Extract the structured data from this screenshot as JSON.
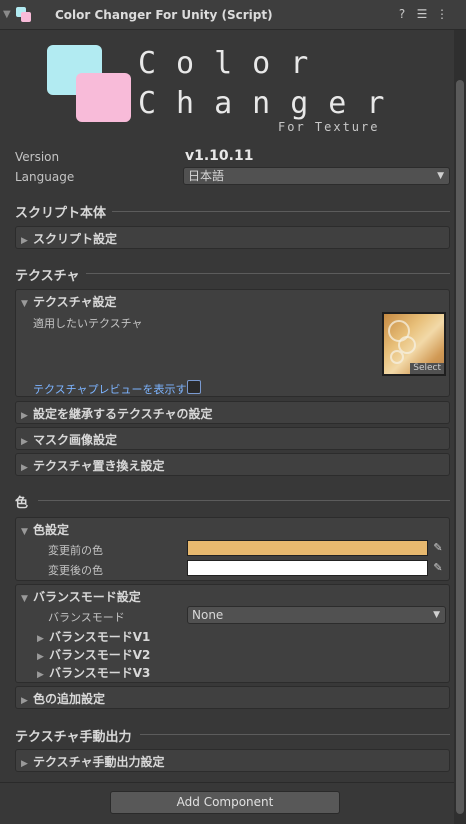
{
  "header": {
    "title": "Color Changer For Unity (Script)",
    "help_icon": "help-icon",
    "settings_icon": "preset-settings-icon",
    "menu_icon": "kebab-menu-icon"
  },
  "logo": {
    "line1": "Color",
    "line2": "Changer",
    "subtitle": "For Texture",
    "colors": {
      "cyan": "#b2ebf2",
      "pink": "#f8bbd9"
    }
  },
  "info": {
    "version_label": "Version",
    "version_value": "v1.10.11",
    "language_label": "Language",
    "language_value": "日本語"
  },
  "sections": {
    "script": {
      "title": "スクリプト本体",
      "foldout": "スクリプト設定"
    },
    "texture": {
      "title": "テクスチャ",
      "foldout_open": "テクスチャ設定",
      "target_label": "適用したいテクスチャ",
      "select_label": "Select",
      "preview_label": "テクスチャプレビューを表示する",
      "preview_checked": false,
      "foldouts": [
        "設定を継承するテクスチャの設定",
        "マスク画像設定",
        "テクスチャ置き換え設定"
      ]
    },
    "color": {
      "title": "色",
      "foldout_open": "色設定",
      "before_label": "変更前の色",
      "before_color": "#e8b96f",
      "after_label": "変更後の色",
      "after_color": "#ffffff",
      "balance_foldout": "バランスモード設定",
      "balance_mode_label": "バランスモード",
      "balance_mode_value": "None",
      "balance_sub": [
        "バランスモードV1",
        "バランスモードV2",
        "バランスモードV3"
      ],
      "extra_foldout": "色の追加設定"
    },
    "manual_output": {
      "title": "テクスチャ手動出力",
      "foldout": "テクスチャ手動出力設定"
    }
  },
  "footer": {
    "add_component": "Add Component"
  }
}
